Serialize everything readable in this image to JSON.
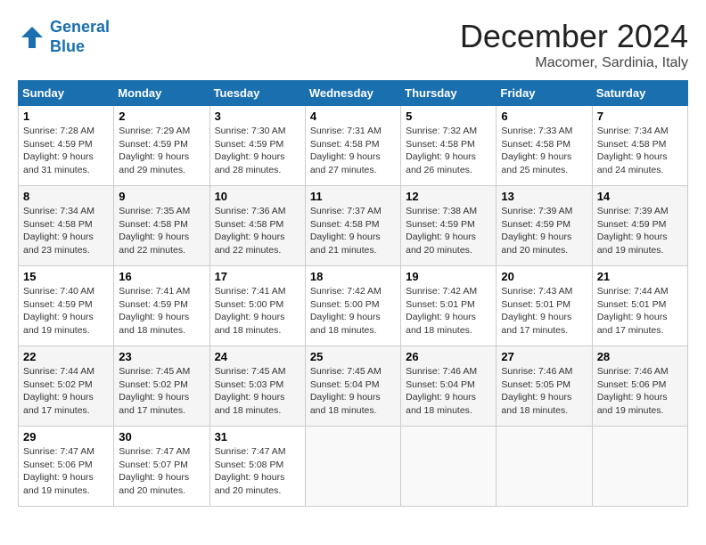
{
  "logo": {
    "line1": "General",
    "line2": "Blue"
  },
  "title": "December 2024",
  "location": "Macomer, Sardinia, Italy",
  "days_of_week": [
    "Sunday",
    "Monday",
    "Tuesday",
    "Wednesday",
    "Thursday",
    "Friday",
    "Saturday"
  ],
  "weeks": [
    [
      {
        "day": "1",
        "sunrise": "Sunrise: 7:28 AM",
        "sunset": "Sunset: 4:59 PM",
        "daylight": "Daylight: 9 hours and 31 minutes."
      },
      {
        "day": "2",
        "sunrise": "Sunrise: 7:29 AM",
        "sunset": "Sunset: 4:59 PM",
        "daylight": "Daylight: 9 hours and 29 minutes."
      },
      {
        "day": "3",
        "sunrise": "Sunrise: 7:30 AM",
        "sunset": "Sunset: 4:59 PM",
        "daylight": "Daylight: 9 hours and 28 minutes."
      },
      {
        "day": "4",
        "sunrise": "Sunrise: 7:31 AM",
        "sunset": "Sunset: 4:58 PM",
        "daylight": "Daylight: 9 hours and 27 minutes."
      },
      {
        "day": "5",
        "sunrise": "Sunrise: 7:32 AM",
        "sunset": "Sunset: 4:58 PM",
        "daylight": "Daylight: 9 hours and 26 minutes."
      },
      {
        "day": "6",
        "sunrise": "Sunrise: 7:33 AM",
        "sunset": "Sunset: 4:58 PM",
        "daylight": "Daylight: 9 hours and 25 minutes."
      },
      {
        "day": "7",
        "sunrise": "Sunrise: 7:34 AM",
        "sunset": "Sunset: 4:58 PM",
        "daylight": "Daylight: 9 hours and 24 minutes."
      }
    ],
    [
      {
        "day": "8",
        "sunrise": "Sunrise: 7:34 AM",
        "sunset": "Sunset: 4:58 PM",
        "daylight": "Daylight: 9 hours and 23 minutes."
      },
      {
        "day": "9",
        "sunrise": "Sunrise: 7:35 AM",
        "sunset": "Sunset: 4:58 PM",
        "daylight": "Daylight: 9 hours and 22 minutes."
      },
      {
        "day": "10",
        "sunrise": "Sunrise: 7:36 AM",
        "sunset": "Sunset: 4:58 PM",
        "daylight": "Daylight: 9 hours and 22 minutes."
      },
      {
        "day": "11",
        "sunrise": "Sunrise: 7:37 AM",
        "sunset": "Sunset: 4:58 PM",
        "daylight": "Daylight: 9 hours and 21 minutes."
      },
      {
        "day": "12",
        "sunrise": "Sunrise: 7:38 AM",
        "sunset": "Sunset: 4:59 PM",
        "daylight": "Daylight: 9 hours and 20 minutes."
      },
      {
        "day": "13",
        "sunrise": "Sunrise: 7:39 AM",
        "sunset": "Sunset: 4:59 PM",
        "daylight": "Daylight: 9 hours and 20 minutes."
      },
      {
        "day": "14",
        "sunrise": "Sunrise: 7:39 AM",
        "sunset": "Sunset: 4:59 PM",
        "daylight": "Daylight: 9 hours and 19 minutes."
      }
    ],
    [
      {
        "day": "15",
        "sunrise": "Sunrise: 7:40 AM",
        "sunset": "Sunset: 4:59 PM",
        "daylight": "Daylight: 9 hours and 19 minutes."
      },
      {
        "day": "16",
        "sunrise": "Sunrise: 7:41 AM",
        "sunset": "Sunset: 4:59 PM",
        "daylight": "Daylight: 9 hours and 18 minutes."
      },
      {
        "day": "17",
        "sunrise": "Sunrise: 7:41 AM",
        "sunset": "Sunset: 5:00 PM",
        "daylight": "Daylight: 9 hours and 18 minutes."
      },
      {
        "day": "18",
        "sunrise": "Sunrise: 7:42 AM",
        "sunset": "Sunset: 5:00 PM",
        "daylight": "Daylight: 9 hours and 18 minutes."
      },
      {
        "day": "19",
        "sunrise": "Sunrise: 7:42 AM",
        "sunset": "Sunset: 5:01 PM",
        "daylight": "Daylight: 9 hours and 18 minutes."
      },
      {
        "day": "20",
        "sunrise": "Sunrise: 7:43 AM",
        "sunset": "Sunset: 5:01 PM",
        "daylight": "Daylight: 9 hours and 17 minutes."
      },
      {
        "day": "21",
        "sunrise": "Sunrise: 7:44 AM",
        "sunset": "Sunset: 5:01 PM",
        "daylight": "Daylight: 9 hours and 17 minutes."
      }
    ],
    [
      {
        "day": "22",
        "sunrise": "Sunrise: 7:44 AM",
        "sunset": "Sunset: 5:02 PM",
        "daylight": "Daylight: 9 hours and 17 minutes."
      },
      {
        "day": "23",
        "sunrise": "Sunrise: 7:45 AM",
        "sunset": "Sunset: 5:02 PM",
        "daylight": "Daylight: 9 hours and 17 minutes."
      },
      {
        "day": "24",
        "sunrise": "Sunrise: 7:45 AM",
        "sunset": "Sunset: 5:03 PM",
        "daylight": "Daylight: 9 hours and 18 minutes."
      },
      {
        "day": "25",
        "sunrise": "Sunrise: 7:45 AM",
        "sunset": "Sunset: 5:04 PM",
        "daylight": "Daylight: 9 hours and 18 minutes."
      },
      {
        "day": "26",
        "sunrise": "Sunrise: 7:46 AM",
        "sunset": "Sunset: 5:04 PM",
        "daylight": "Daylight: 9 hours and 18 minutes."
      },
      {
        "day": "27",
        "sunrise": "Sunrise: 7:46 AM",
        "sunset": "Sunset: 5:05 PM",
        "daylight": "Daylight: 9 hours and 18 minutes."
      },
      {
        "day": "28",
        "sunrise": "Sunrise: 7:46 AM",
        "sunset": "Sunset: 5:06 PM",
        "daylight": "Daylight: 9 hours and 19 minutes."
      }
    ],
    [
      {
        "day": "29",
        "sunrise": "Sunrise: 7:47 AM",
        "sunset": "Sunset: 5:06 PM",
        "daylight": "Daylight: 9 hours and 19 minutes."
      },
      {
        "day": "30",
        "sunrise": "Sunrise: 7:47 AM",
        "sunset": "Sunset: 5:07 PM",
        "daylight": "Daylight: 9 hours and 20 minutes."
      },
      {
        "day": "31",
        "sunrise": "Sunrise: 7:47 AM",
        "sunset": "Sunset: 5:08 PM",
        "daylight": "Daylight: 9 hours and 20 minutes."
      },
      null,
      null,
      null,
      null
    ]
  ]
}
